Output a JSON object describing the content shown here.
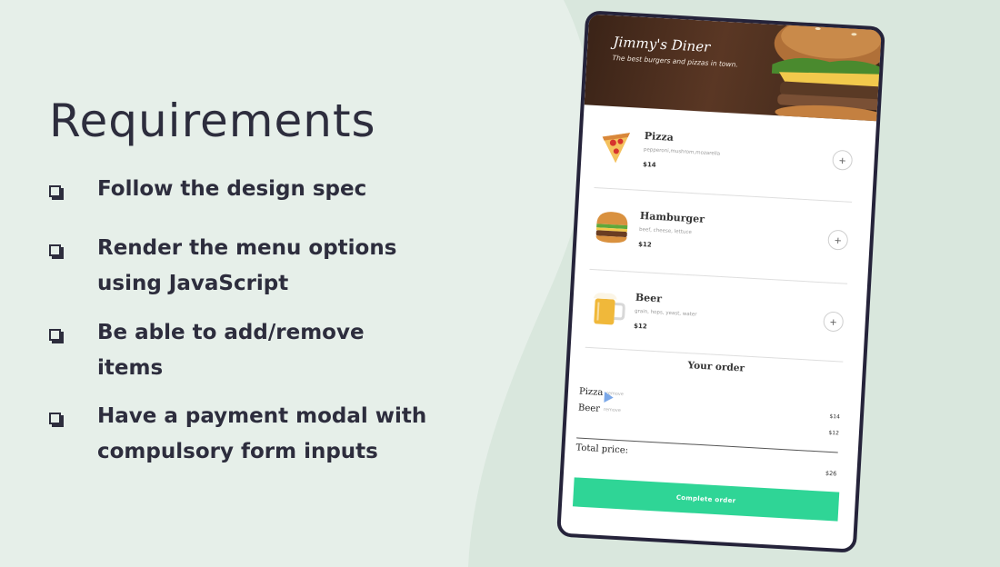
{
  "slide": {
    "title": "Requirements",
    "items": [
      "Follow the design spec",
      "Render the menu options using JavaScript",
      "Be able to add/remove items",
      "Have a payment modal with compulsory form inputs"
    ]
  },
  "app": {
    "restaurant_name": "Jimmy's Diner",
    "tagline": "The best burgers and pizzas in town.",
    "menu": [
      {
        "name": "Pizza",
        "ingredients": "pepperoni,mushrom,mozarella",
        "price": "$14",
        "icon": "pizza-icon"
      },
      {
        "name": "Hamburger",
        "ingredients": "beef, cheese, lettuce",
        "price": "$12",
        "icon": "hamburger-icon"
      },
      {
        "name": "Beer",
        "ingredients": "grain, hops, yeast, water",
        "price": "$12",
        "icon": "beer-icon"
      }
    ],
    "add_label": "+",
    "order": {
      "title": "Your order",
      "items": [
        {
          "name": "Pizza",
          "remove_label": "remove",
          "price": "$14"
        },
        {
          "name": "Beer",
          "remove_label": "remove",
          "price": "$12"
        }
      ],
      "total_label": "Total price:",
      "total_value": "$26"
    },
    "complete_button": "Complete order"
  },
  "colors": {
    "background": "#e6efe9",
    "accent": "#2fd596",
    "text": "#2d2d3d",
    "phone_frame": "#25233a"
  }
}
